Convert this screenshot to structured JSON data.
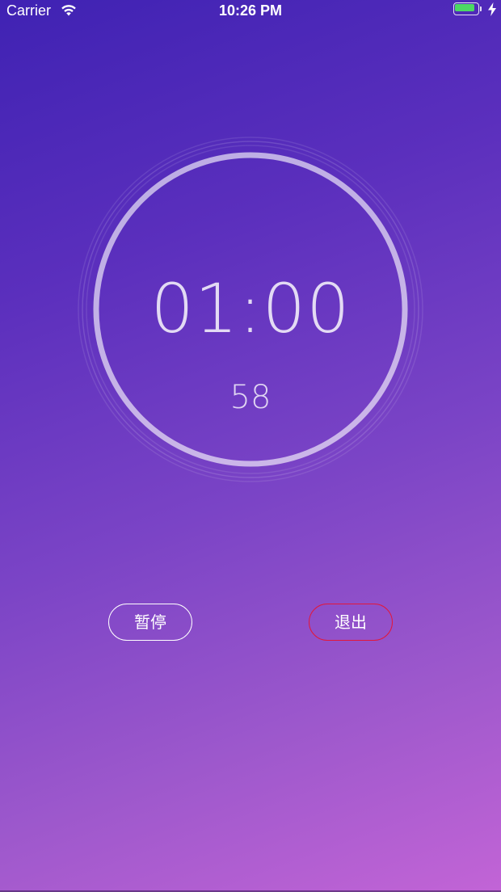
{
  "status_bar": {
    "carrier": "Carrier",
    "time": "10:26 PM",
    "battery_fill_fraction": 0.9,
    "battery_color": "#4cd964",
    "icons": [
      "wifi-icon",
      "battery-icon",
      "charging-bolt-icon"
    ]
  },
  "timer": {
    "main_time": "01:00",
    "sub_count": "58",
    "ring_color": "#ffffff"
  },
  "controls": {
    "pause_label": "暂停",
    "exit_label": "退出",
    "pause_border_color": "#ffffff",
    "exit_border_color": "#e2173b"
  },
  "theme": {
    "gradient_start": "#3f22b3",
    "gradient_end": "#c264d6"
  }
}
